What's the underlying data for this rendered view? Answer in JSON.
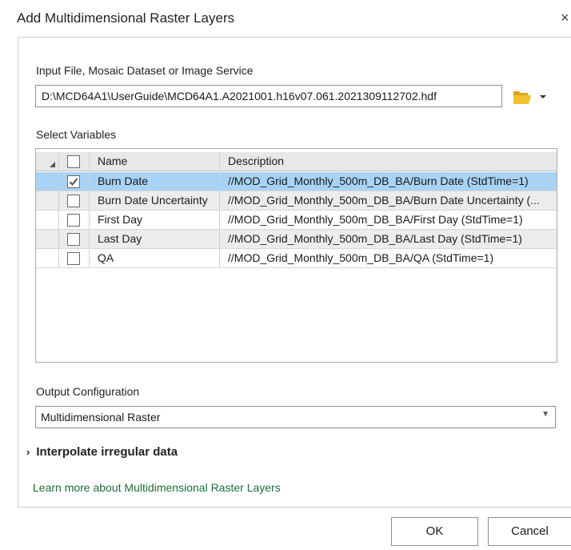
{
  "window": {
    "title": "Add Multidimensional Raster Layers",
    "close_glyph": "×"
  },
  "input": {
    "label": "Input File, Mosaic Dataset or Image Service",
    "value": "D:\\MCD64A1\\UserGuide\\MCD64A1.A2021001.h16v07.061.2021309112702.hdf",
    "browse_icon": "folder-open-icon",
    "dropdown_icon": "caret-down-icon"
  },
  "variables": {
    "label": "Select Variables",
    "columns": {
      "name": "Name",
      "description": "Description"
    },
    "rows": [
      {
        "name": "Burn Date",
        "description": "//MOD_Grid_Monthly_500m_DB_BA/Burn Date (StdTime=1)",
        "checked": true,
        "selected": true
      },
      {
        "name": "Burn Date Uncertainty",
        "description": "//MOD_Grid_Monthly_500m_DB_BA/Burn Date Uncertainty (...",
        "checked": false,
        "selected": false
      },
      {
        "name": "First Day",
        "description": "//MOD_Grid_Monthly_500m_DB_BA/First Day (StdTime=1)",
        "checked": false,
        "selected": false
      },
      {
        "name": "Last Day",
        "description": "//MOD_Grid_Monthly_500m_DB_BA/Last Day (StdTime=1)",
        "checked": false,
        "selected": false
      },
      {
        "name": "QA",
        "description": "//MOD_Grid_Monthly_500m_DB_BA/QA (StdTime=1)",
        "checked": false,
        "selected": false
      }
    ]
  },
  "output": {
    "label": "Output Configuration",
    "value": "Multidimensional Raster"
  },
  "interpolate": {
    "label": "Interpolate irregular data",
    "chevron": "›"
  },
  "learn_more": "Learn more about Multidimensional Raster Layers",
  "buttons": {
    "ok": "OK",
    "cancel": "Cancel"
  },
  "colors": {
    "selected_row": "#a9d3f5",
    "link": "#1b6d3c",
    "folder": "#f2c230"
  }
}
